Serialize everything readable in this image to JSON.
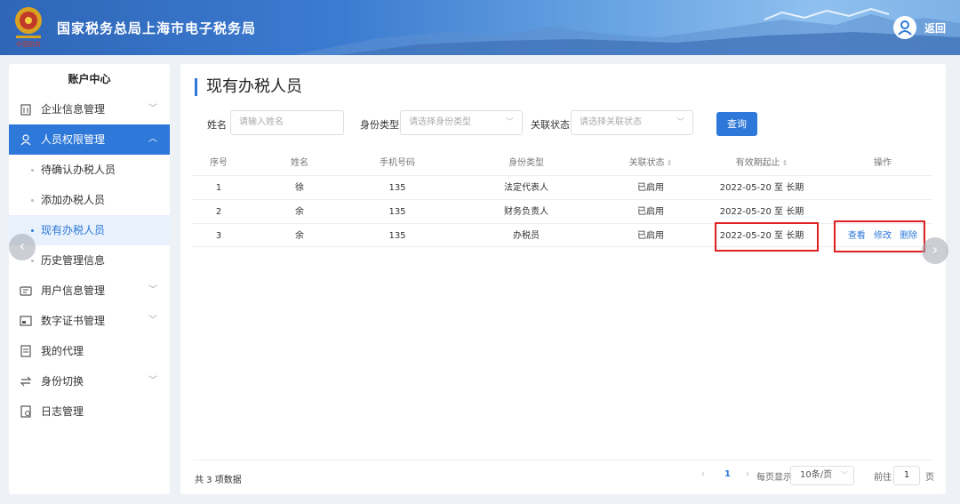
{
  "header": {
    "title": "国家税务总局上海市电子税务局",
    "back_label": "返回",
    "colors": {
      "accent": "#2d78d8",
      "header_start": "#2f66b8",
      "header_end": "#8fc0ef",
      "highlight": "#e02020"
    }
  },
  "sidebar": {
    "title": "账户中心",
    "items": [
      {
        "label": "企业信息管理",
        "icon": "building-icon",
        "expandable": true
      },
      {
        "label": "人员权限管理",
        "icon": "person-icon",
        "expandable": true,
        "active": true
      },
      {
        "label": "用户信息管理",
        "icon": "id-card-icon",
        "expandable": true
      },
      {
        "label": "数字证书管理",
        "icon": "certificate-icon",
        "expandable": true
      },
      {
        "label": "我的代理",
        "icon": "document-icon",
        "expandable": false
      },
      {
        "label": "身份切换",
        "icon": "switch-icon",
        "expandable": true
      },
      {
        "label": "日志管理",
        "icon": "log-icon",
        "expandable": false
      }
    ],
    "sub_items": [
      {
        "label": "待确认办税人员"
      },
      {
        "label": "添加办税人员"
      },
      {
        "label": "现有办税人员",
        "current": true
      },
      {
        "label": "历史管理信息"
      }
    ]
  },
  "main": {
    "title": "现有办税人员",
    "filters": {
      "name_label": "姓名",
      "name_placeholder": "请输入姓名",
      "id_type_label": "身份类型",
      "id_type_placeholder": "请选择身份类型",
      "status_label": "关联状态",
      "status_placeholder": "请选择关联状态",
      "query_label": "查询"
    },
    "table": {
      "headers": [
        "序号",
        "姓名",
        "手机号码",
        "身份类型",
        "关联状态",
        "有效期起止",
        "操作"
      ],
      "rows": [
        {
          "index": "1",
          "name": "徐",
          "phone": "135",
          "id_type": "法定代表人",
          "status": "已启用",
          "validity": "2022-05-20 至 长期"
        },
        {
          "index": "2",
          "name": "余",
          "phone": "135",
          "id_type": "财务负责人",
          "status": "已启用",
          "validity": "2022-05-20 至 长期"
        },
        {
          "index": "3",
          "name": "余",
          "phone": "135",
          "id_type": "办税员",
          "status": "已启用",
          "validity": "2022-05-20 至 长期",
          "actions": [
            "查看",
            "修改",
            "删除"
          ]
        }
      ]
    },
    "footer": {
      "total": "共 3 项数据",
      "current_page": "1",
      "page_size_label": "每页显示",
      "page_size": "10条/页",
      "goto_label": "前往",
      "goto_value": "1",
      "goto_suffix": "页"
    }
  }
}
